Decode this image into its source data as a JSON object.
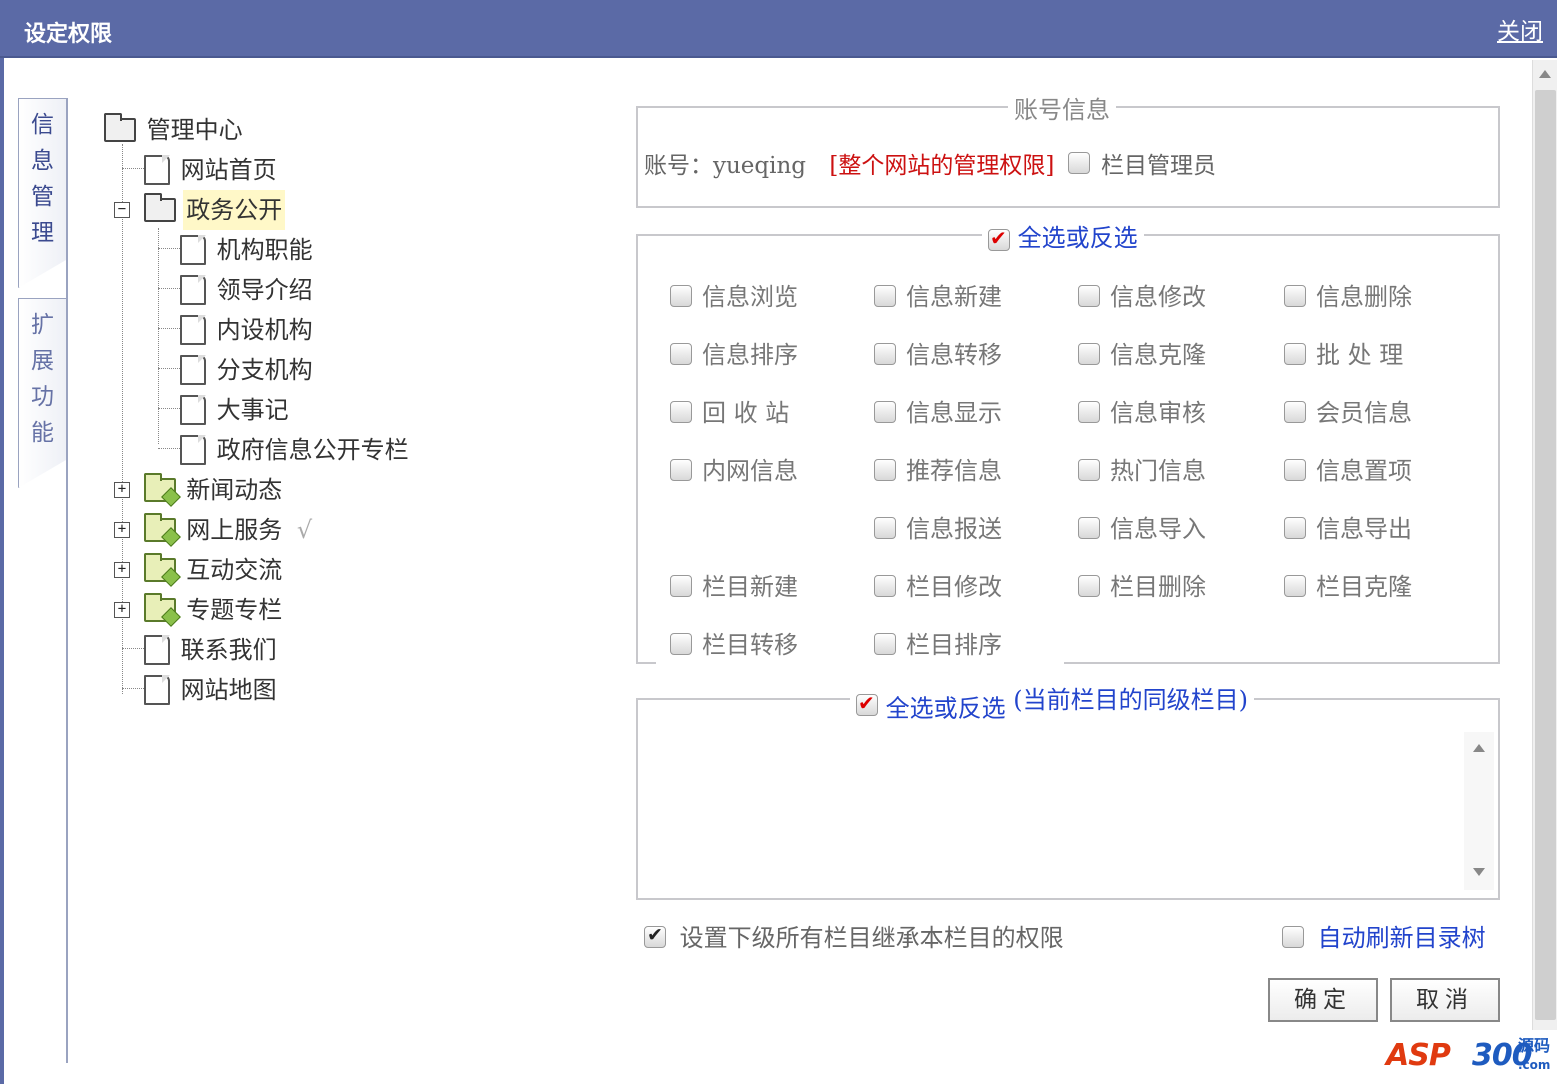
{
  "window": {
    "title": "设定权限",
    "close_label": "关闭"
  },
  "tabs": {
    "active": [
      "信",
      "息",
      "管",
      "理"
    ],
    "inactive": [
      "扩",
      "展",
      "功",
      "能"
    ]
  },
  "tree": {
    "root": "管理中心",
    "items": [
      "网站首页",
      "政务公开",
      "机构职能",
      "领导介绍",
      "内设机构",
      "分支机构",
      "大事记",
      "政府信息公开专栏",
      "新闻动态",
      "网上服务",
      "互动交流",
      "专题专栏",
      "联系我们",
      "网站地图"
    ],
    "expanded_toggle": "−",
    "collapsed_toggle": "+",
    "check_symbol": "√"
  },
  "account": {
    "legend": "账号信息",
    "label": "账号：yueqing",
    "scope": "[整个网站的管理权限]",
    "column_admin_label": "栏目管理员"
  },
  "permissions": {
    "legend": "全选或反选",
    "rows": [
      [
        "信息浏览",
        "信息新建",
        "信息修改",
        "信息删除"
      ],
      [
        "信息排序",
        "信息转移",
        "信息克隆",
        "批 处 理"
      ],
      [
        "回 收 站",
        "信息显示",
        "信息审核",
        "会员信息"
      ],
      [
        "内网信息",
        "推荐信息",
        "热门信息",
        "信息置项"
      ],
      [
        "",
        "信息报送",
        "信息导入",
        "信息导出"
      ],
      [
        "栏目新建",
        "栏目修改",
        "栏目删除",
        "栏目克隆"
      ],
      [
        "栏目转移",
        "栏目排序",
        "",
        ""
      ]
    ]
  },
  "sibling": {
    "legend": "全选或反选",
    "note": "(当前栏目的同级栏目)"
  },
  "options": {
    "inherit_label": "设置下级所有栏目继承本栏目的权限",
    "auto_refresh_label": "自动刷新目录树"
  },
  "buttons": {
    "ok": "确定",
    "cancel": "取消"
  },
  "logo": {
    "part1": "ASP",
    "part2": "300",
    "cn": "源码",
    "com": ".com"
  },
  "colors": {
    "titlebar": "#5b6aa6",
    "link_blue": "#2244cc",
    "scope_red": "#cc1111"
  }
}
